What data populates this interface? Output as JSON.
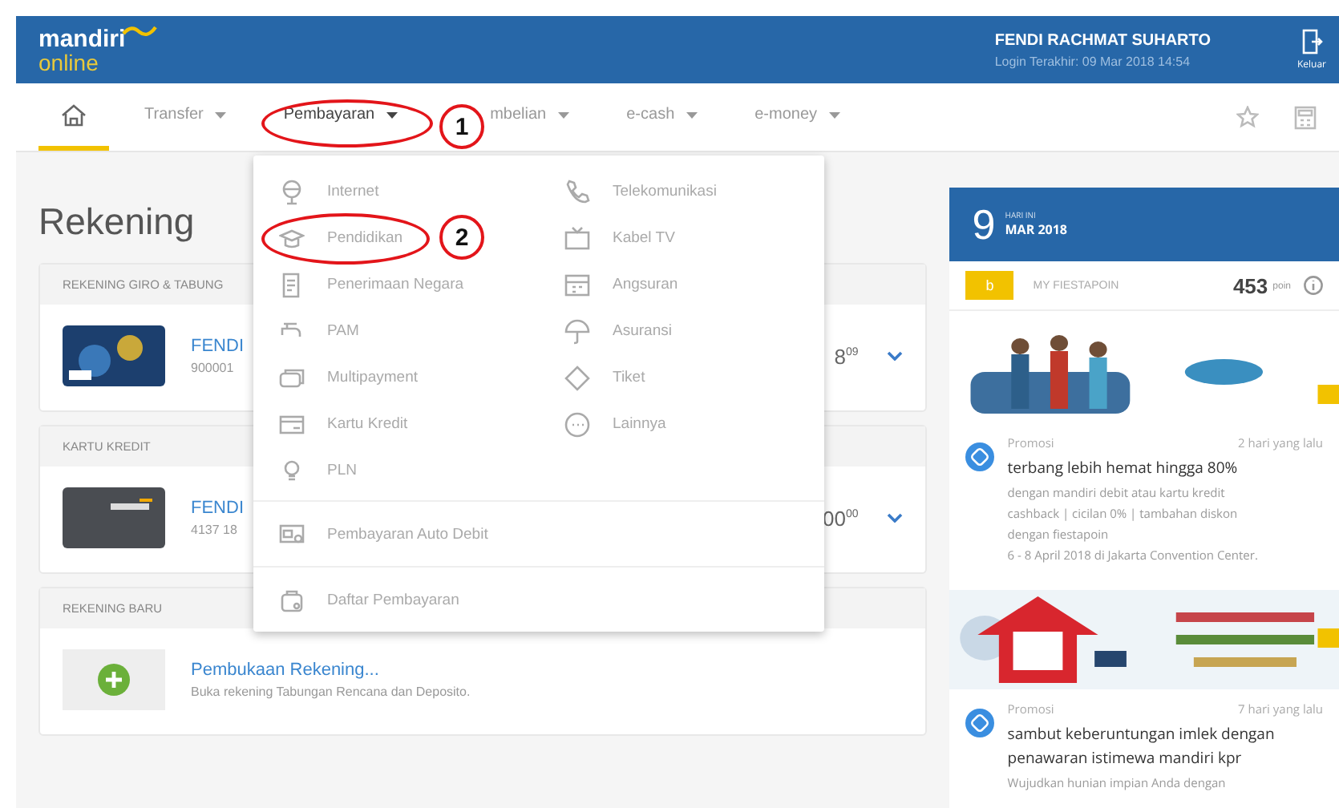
{
  "header": {
    "logo_top": "mandiri",
    "logo_bottom": "online",
    "user_name": "FENDI RACHMAT SUHARTO",
    "last_login": "Login Terakhir: 09 Mar 2018 14:54",
    "logout": "Keluar"
  },
  "nav": [
    {
      "kind": "home",
      "selected": true
    },
    {
      "label": "Transfer",
      "kind": "menu",
      "selected": false
    },
    {
      "label": "Pembayaran",
      "kind": "menu",
      "selected": false
    },
    {
      "label": "mbelian",
      "kind": "menu",
      "selected": false
    },
    {
      "label": "e-cash",
      "kind": "menu",
      "selected": false
    },
    {
      "label": "e-money",
      "kind": "menu",
      "selected": false
    }
  ],
  "page_title": "Rekening",
  "sections": [
    {
      "title": "REKENING GIRO & TABUNG",
      "rows": [
        {
          "kind": "debit",
          "name": "FENDI",
          "number": "900001",
          "amount": "8$^{09}$"
        }
      ]
    },
    {
      "title": "KARTU KREDIT",
      "rows": [
        {
          "kind": "credit",
          "name": "FENDI",
          "number": "4137 18",
          "amount": "00$^{00}$"
        }
      ]
    },
    {
      "title": "REKENING BARU",
      "rows": [
        {
          "kind": "new",
          "name": "Pembukaan Rekening...",
          "number": "Buka rekening Tabungan Rencana dan Deposito."
        }
      ]
    }
  ],
  "dropdown": {
    "columns": [
      [
        "Internet",
        "Pendidikan",
        "Penerimaan Negara",
        "PAM",
        "Multipayment",
        "Kartu Kredit",
        "PLN"
      ],
      [
        "Telekomunikasi",
        "Kabel TV",
        "Angsuran",
        "Asuransi",
        "Tiket",
        "Lainnya"
      ]
    ],
    "extra": [
      "Pembayaran Auto Debit",
      "Daftar Pembayaran"
    ]
  },
  "annotations": [
    {
      "label": "1"
    },
    {
      "label": "2"
    }
  ],
  "side": {
    "day": "9",
    "day_label": "HARI INI",
    "month": "MAR 2018",
    "points_badge": "b",
    "points_label": "MY FIESTAPOIN",
    "points": "453",
    "points_unit": "poin",
    "promos": [
      {
        "tag": "Promosi",
        "time": "2 hari yang lalu",
        "title": "terbang lebih hemat hingga 80%",
        "lines": [
          "dengan mandiri debit atau kartu kredit",
          "cashback | cicilan 0% | tambahan diskon",
          "dengan fiestapoin",
          "6 - 8 April 2018 di Jakarta Convention Center."
        ]
      },
      {
        "tag": "Promosi",
        "time": "7 hari yang lalu",
        "title": "sambut keberuntungan imlek dengan penawaran istimewa mandiri kpr",
        "lines": [
          "Wujudkan hunian impian Anda dengan"
        ]
      }
    ]
  }
}
